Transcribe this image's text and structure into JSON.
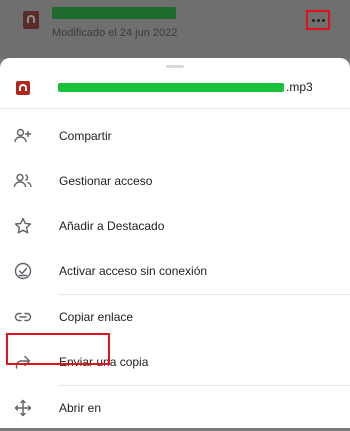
{
  "background": {
    "file_subtitle": "Modificado el 24 jun 2022"
  },
  "sheet": {
    "file_extension": ".mp3",
    "items": [
      {
        "label": "Compartir",
        "icon": "person-add-icon"
      },
      {
        "label": "Gestionar acceso",
        "icon": "people-icon"
      },
      {
        "label": "Añadir a Destacado",
        "icon": "star-icon"
      },
      {
        "label": "Activar acceso sin conexión",
        "icon": "offline-check-icon"
      },
      {
        "label": "Copiar enlace",
        "icon": "link-icon"
      },
      {
        "label": "Enviar una copia",
        "icon": "forward-icon"
      },
      {
        "label": "Abrir en",
        "icon": "open-with-icon"
      }
    ]
  },
  "colors": {
    "highlight": "#e0101e",
    "redaction": "#19c23a",
    "file_icon": "#b3261e"
  }
}
